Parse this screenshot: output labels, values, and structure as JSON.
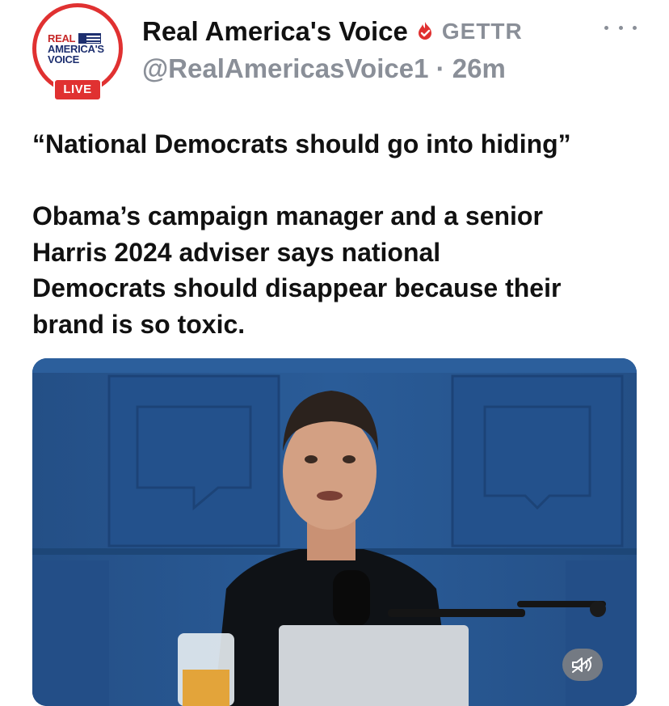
{
  "post": {
    "author": {
      "display_name": "Real America's Voice",
      "platform": "GETTR",
      "handle": "@RealAmericasVoice1",
      "separator": "·",
      "time": "26m",
      "avatar": {
        "line1": "REAL",
        "line2": "AMERICA'S",
        "line3": "VOICE",
        "live_badge": "LIVE"
      },
      "verified_icon": "flame-verified-icon",
      "verified_color": "#e03131"
    },
    "more_icon": "more-horizontal-icon",
    "quote": "“National Democrats should go into hiding”",
    "body_lines": [
      "Obama’s campaign manager and a senior",
      "Harris 2024 adviser says national",
      "Democrats should disappear because their",
      "brand is so toxic."
    ],
    "video": {
      "mute_icon": "speaker-muted-icon"
    }
  }
}
